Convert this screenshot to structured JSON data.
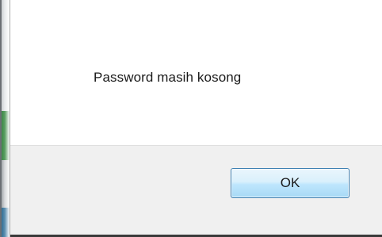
{
  "dialog": {
    "message": "Password masih kosong",
    "ok_label": "OK"
  },
  "colors": {
    "footer_background": "#f0f0f0",
    "button_border": "#3c7fb1",
    "button_fill": "#bee6fd"
  }
}
